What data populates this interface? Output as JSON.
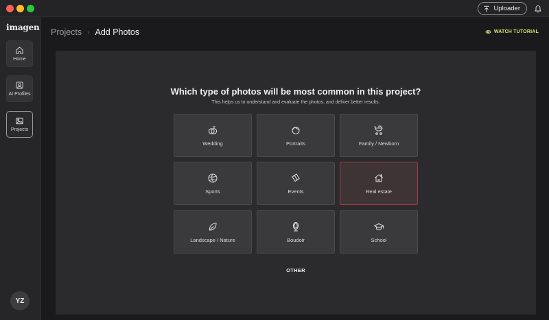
{
  "window": {
    "uploader_label": "Uploader"
  },
  "sidebar": {
    "logo": "imagen",
    "items": [
      {
        "label": "Home",
        "icon": "home-icon"
      },
      {
        "label": "AI Profiles",
        "icon": "ai-profile-icon"
      },
      {
        "label": "Projects",
        "icon": "image-icon"
      }
    ],
    "avatar_initials": "YZ"
  },
  "header": {
    "breadcrumb_root": "Projects",
    "breadcrumb_current": "Add Photos",
    "watch_tutorial": "WATCH TUTORIAL"
  },
  "main": {
    "question": "Which type of photos will be most common in this project?",
    "subtitle": "This helps us to understand and evaluate the photos, and deliver better results.",
    "categories": [
      {
        "label": "Wedding",
        "icon": "rings-icon"
      },
      {
        "label": "Portraits",
        "icon": "portrait-icon"
      },
      {
        "label": "Family / Newborn",
        "icon": "stroller-icon"
      },
      {
        "label": "Sports",
        "icon": "ball-icon"
      },
      {
        "label": "Events",
        "icon": "ticket-icon"
      },
      {
        "label": "Real estate",
        "icon": "house-icon",
        "selected": true
      },
      {
        "label": "Landscape / Nature",
        "icon": "leaf-icon"
      },
      {
        "label": "Boudoir",
        "icon": "mirror-icon"
      },
      {
        "label": "School",
        "icon": "graduation-cap-icon"
      }
    ],
    "other_label": "OTHER"
  },
  "colors": {
    "accent_yellow": "#dfe57a",
    "selected_border": "#a23a48",
    "card_bg": "#3a3a3d",
    "panel_bg": "#2b2b2d"
  }
}
